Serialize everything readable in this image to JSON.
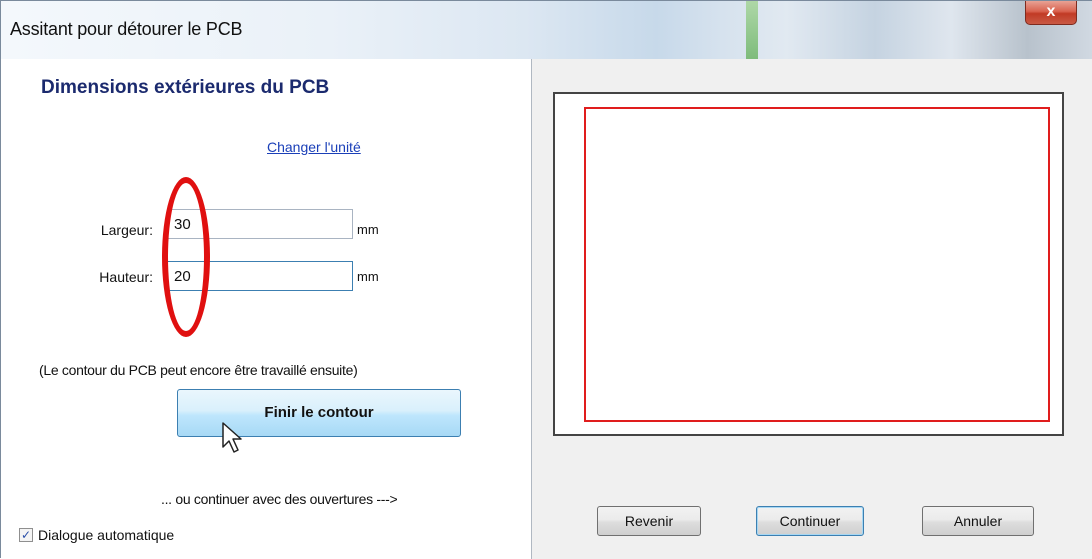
{
  "window": {
    "title": "Assitant pour détourer le PCB",
    "close_glyph": "x"
  },
  "left": {
    "heading": "Dimensions extérieures du PCB",
    "change_unit_link": "Changer l'unité",
    "width": {
      "label": "Largeur:",
      "value": "30",
      "unit": "mm"
    },
    "height": {
      "label": "Hauteur:",
      "value": "20",
      "unit": "mm"
    },
    "note": "(Le contour du PCB peut encore être travaillé ensuite)",
    "finish_button": "Finir le contour",
    "continue_text": "... ou continuer avec des ouvertures --->",
    "auto_dialog": {
      "label": "Dialogue automatique",
      "checked": true,
      "check_glyph": "✓"
    }
  },
  "buttons": {
    "back": "Revenir",
    "next": "Continuer",
    "cancel": "Annuler"
  },
  "colors": {
    "heading": "#1b2a6e",
    "link": "#1a3fb8",
    "pcb_outline": "#e01d1d",
    "annotation_oval": "#e01010",
    "button_border": "#3c7fb1"
  },
  "icons": {
    "close": "close-icon",
    "check": "checkmark-icon",
    "cursor": "mouse-pointer-icon"
  }
}
